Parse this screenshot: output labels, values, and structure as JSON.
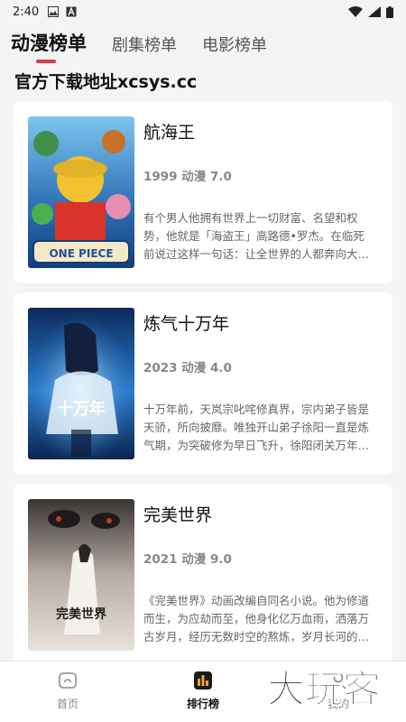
{
  "status_bar": {
    "time": "2:40"
  },
  "tabs": [
    {
      "label": "动漫榜单",
      "active": true
    },
    {
      "label": "剧集榜单",
      "active": false
    },
    {
      "label": "电影榜单",
      "active": false
    }
  ],
  "download_notice": "官方下载地址xcsys.cc",
  "cards": [
    {
      "title": "航海王",
      "meta": "1999 动漫 7.0",
      "description": "有个男人他拥有世界上一切财富、名望和权势，他就是「海盗王」高路德•罗杰。在临死前说过这样一句话：让全世界的人都奔向大海「想要我的财宝吗？",
      "poster_lettering": "ONE PIECE",
      "poster_colors": [
        "#2c6fb6",
        "#f2c230",
        "#d8342c"
      ]
    },
    {
      "title": "炼气十万年",
      "meta": "2023 动漫 4.0",
      "description": "十万年前，天岚宗叱咤修真界，宗内弟子皆是天骄，所向披靡。唯独开山弟子徐阳一直是炼气期，为突破修为早日飞升，徐阳闭关万年。谁知出关时，修为…",
      "poster_lettering": "十万年",
      "poster_colors": [
        "#0d2b5c",
        "#2a7ccd",
        "#9ad4f5"
      ]
    },
    {
      "title": "完美世界",
      "meta": "2021 动漫 9.0",
      "description": "《完美世界》动画改编自同名小说。他为修道而生，为应劫而至，他身化亿万血雨，洒落万古岁月，经历无数时空的熬炼，岁月长河的洗礼，他化万古，…",
      "poster_lettering": "完美世界",
      "poster_colors": [
        "#3a3433",
        "#b7aca3",
        "#e8e2da"
      ]
    }
  ],
  "bottom_nav": [
    {
      "label": "首页",
      "icon": "home-icon",
      "active": false
    },
    {
      "label": "排行榜",
      "icon": "ranking-icon",
      "active": true
    },
    {
      "label": "我的",
      "icon": "profile-icon",
      "active": false
    }
  ],
  "watermark": "大玩客",
  "accent_color": "#e2364a"
}
